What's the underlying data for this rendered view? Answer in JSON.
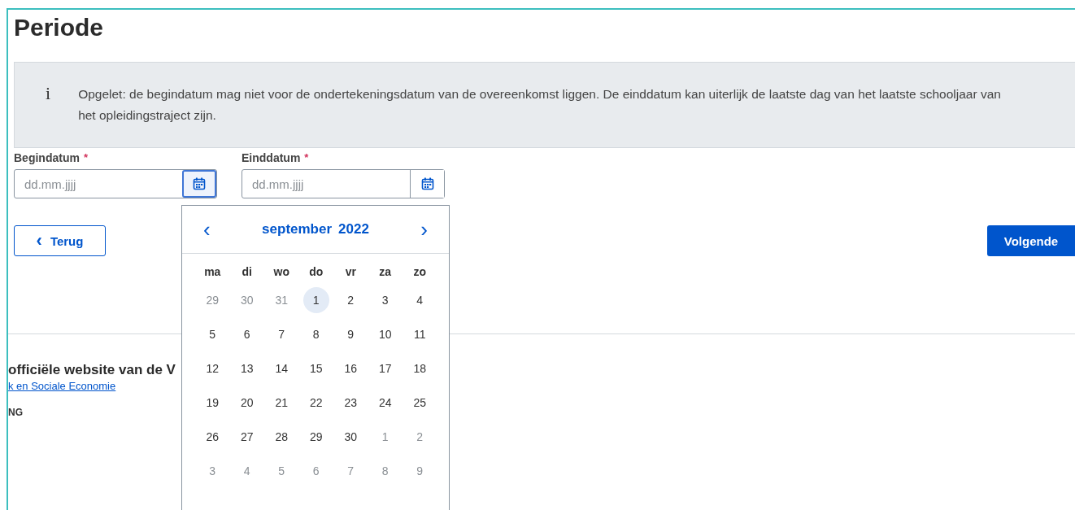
{
  "title": "Periode",
  "info": {
    "icon": "i",
    "text": "Opgelet: de begindatum mag niet voor de ondertekeningsdatum van de overeenkomst liggen. De einddatum kan uiterlijk de laatste dag van het laatste schooljaar van het opleidingstraject zijn."
  },
  "fields": [
    {
      "label": "Begindatum",
      "required": true,
      "placeholder": "dd.mm.jjjj",
      "focused": true
    },
    {
      "label": "Einddatum",
      "required": true,
      "placeholder": "dd.mm.jjjj",
      "focused": false
    }
  ],
  "required_mark": "*",
  "datepicker": {
    "prev": "‹",
    "next": "›",
    "month": "september",
    "year": "2022",
    "weekdays": [
      "ma",
      "di",
      "wo",
      "do",
      "vr",
      "za",
      "zo"
    ],
    "days": [
      {
        "day": "29",
        "outside": true,
        "selected": false
      },
      {
        "day": "30",
        "outside": true,
        "selected": false
      },
      {
        "day": "31",
        "outside": true,
        "selected": false
      },
      {
        "day": "1",
        "outside": false,
        "selected": true
      },
      {
        "day": "2",
        "outside": false,
        "selected": false
      },
      {
        "day": "3",
        "outside": false,
        "selected": false
      },
      {
        "day": "4",
        "outside": false,
        "selected": false
      },
      {
        "day": "5",
        "outside": false,
        "selected": false
      },
      {
        "day": "6",
        "outside": false,
        "selected": false
      },
      {
        "day": "7",
        "outside": false,
        "selected": false
      },
      {
        "day": "8",
        "outside": false,
        "selected": false
      },
      {
        "day": "9",
        "outside": false,
        "selected": false
      },
      {
        "day": "10",
        "outside": false,
        "selected": false
      },
      {
        "day": "11",
        "outside": false,
        "selected": false
      },
      {
        "day": "12",
        "outside": false,
        "selected": false
      },
      {
        "day": "13",
        "outside": false,
        "selected": false
      },
      {
        "day": "14",
        "outside": false,
        "selected": false
      },
      {
        "day": "15",
        "outside": false,
        "selected": false
      },
      {
        "day": "16",
        "outside": false,
        "selected": false
      },
      {
        "day": "17",
        "outside": false,
        "selected": false
      },
      {
        "day": "18",
        "outside": false,
        "selected": false
      },
      {
        "day": "19",
        "outside": false,
        "selected": false
      },
      {
        "day": "20",
        "outside": false,
        "selected": false
      },
      {
        "day": "21",
        "outside": false,
        "selected": false
      },
      {
        "day": "22",
        "outside": false,
        "selected": false
      },
      {
        "day": "23",
        "outside": false,
        "selected": false
      },
      {
        "day": "24",
        "outside": false,
        "selected": false
      },
      {
        "day": "25",
        "outside": false,
        "selected": false
      },
      {
        "day": "26",
        "outside": false,
        "selected": false
      },
      {
        "day": "27",
        "outside": false,
        "selected": false
      },
      {
        "day": "28",
        "outside": false,
        "selected": false
      },
      {
        "day": "29",
        "outside": false,
        "selected": false
      },
      {
        "day": "30",
        "outside": false,
        "selected": false
      },
      {
        "day": "1",
        "outside": true,
        "selected": false
      },
      {
        "day": "2",
        "outside": true,
        "selected": false
      },
      {
        "day": "3",
        "outside": true,
        "selected": false
      },
      {
        "day": "4",
        "outside": true,
        "selected": false
      },
      {
        "day": "5",
        "outside": true,
        "selected": false
      },
      {
        "day": "6",
        "outside": true,
        "selected": false
      },
      {
        "day": "7",
        "outside": true,
        "selected": false
      },
      {
        "day": "8",
        "outside": true,
        "selected": false
      },
      {
        "day": "9",
        "outside": true,
        "selected": false
      }
    ]
  },
  "buttons": {
    "back": {
      "icon": "‹",
      "label": "Terug"
    },
    "next": {
      "label": "Volgende"
    }
  },
  "footer": {
    "heading": "officiële website van de V",
    "link": "k en Sociale Economie",
    "label": "NG"
  }
}
